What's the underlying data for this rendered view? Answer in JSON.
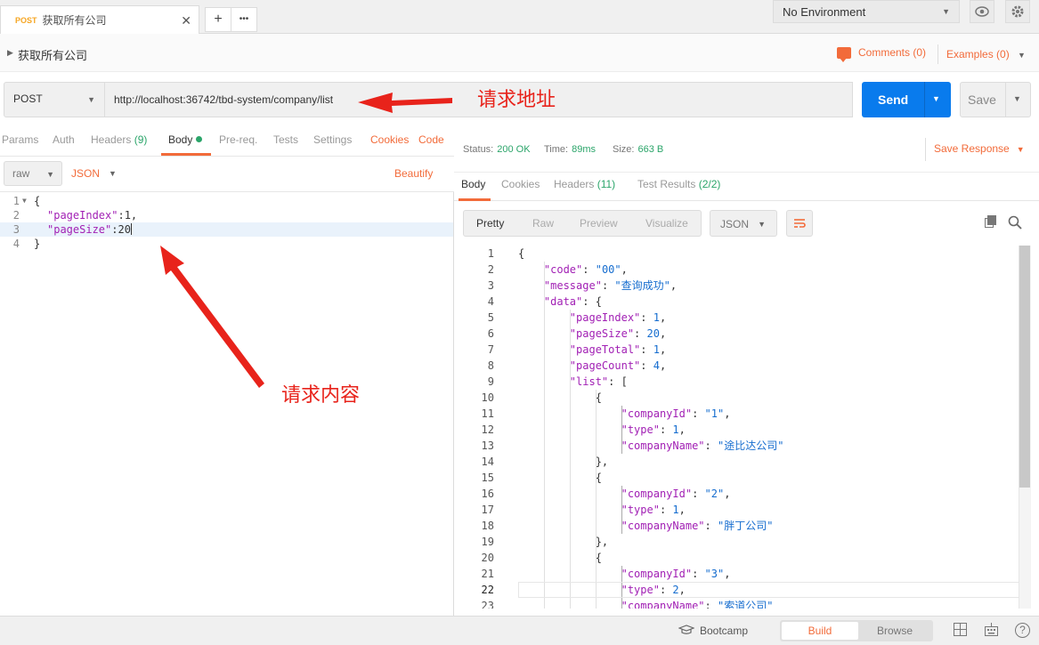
{
  "tab": {
    "method": "POST",
    "title": "获取所有公司"
  },
  "tabbar": {
    "add_icon": "+",
    "more_icon": "•••"
  },
  "environment": {
    "label": "No Environment"
  },
  "request": {
    "name": "获取所有公司",
    "method": "POST",
    "url": "http://localhost:36742/tbd-system/company/list"
  },
  "header_links": {
    "comments": "Comments (0)",
    "examples": "Examples (0)"
  },
  "buttons": {
    "send": "Send",
    "save": "Save"
  },
  "left_tabs": {
    "params": "Params",
    "auth": "Auth",
    "headers": "Headers",
    "headers_count": "(9)",
    "body": "Body",
    "prereq": "Pre-req.",
    "tests": "Tests",
    "settings": "Settings",
    "cookies": "Cookies",
    "code": "Code"
  },
  "body_options": {
    "mode": "raw",
    "format": "JSON",
    "beautify": "Beautify"
  },
  "request_body": [
    {
      "ln": "1",
      "text": "{"
    },
    {
      "ln": "2",
      "key": "\"pageIndex\"",
      "rest": ":1,"
    },
    {
      "ln": "3",
      "key": "\"pageSize\"",
      "rest": ":20"
    },
    {
      "ln": "4",
      "text": "}"
    }
  ],
  "status": {
    "status_label": "Status:",
    "status": "200 OK",
    "time_label": "Time:",
    "time": "89ms",
    "size_label": "Size:",
    "size": "663 B"
  },
  "save_response": "Save Response",
  "response_tabs": {
    "body": "Body",
    "cookies": "Cookies",
    "headers": "Headers",
    "headers_count": "(11)",
    "tests": "Test Results",
    "tests_count": "(2/2)"
  },
  "view_options": {
    "pretty": "Pretty",
    "raw": "Raw",
    "preview": "Preview",
    "visualize": "Visualize",
    "format": "JSON"
  },
  "response_lines": [
    "{",
    "    \"code\": \"00\",",
    "    \"message\": \"查询成功\",",
    "    \"data\": {",
    "        \"pageIndex\": 1,",
    "        \"pageSize\": 20,",
    "        \"pageTotal\": 1,",
    "        \"pageCount\": 4,",
    "        \"list\": [",
    "            {",
    "                \"companyId\": \"1\",",
    "                \"type\": 1,",
    "                \"companyName\": \"途比达公司\"",
    "            },",
    "            {",
    "                \"companyId\": \"2\",",
    "                \"type\": 1,",
    "                \"companyName\": \"胖丁公司\"",
    "            },",
    "            {",
    "                \"companyId\": \"3\",",
    "                \"type\": 2,",
    "                \"companyName\": \"索道公司\""
  ],
  "footer": {
    "bootcamp": "Bootcamp",
    "build": "Build",
    "browse": "Browse",
    "help_icon": "?"
  },
  "annotations": {
    "url_note": "请求地址",
    "body_note": "请求内容"
  },
  "colors": {
    "accent": "#f26b3a",
    "send": "#097bed",
    "success": "#2ba56a",
    "annotation": "#e8231b"
  }
}
